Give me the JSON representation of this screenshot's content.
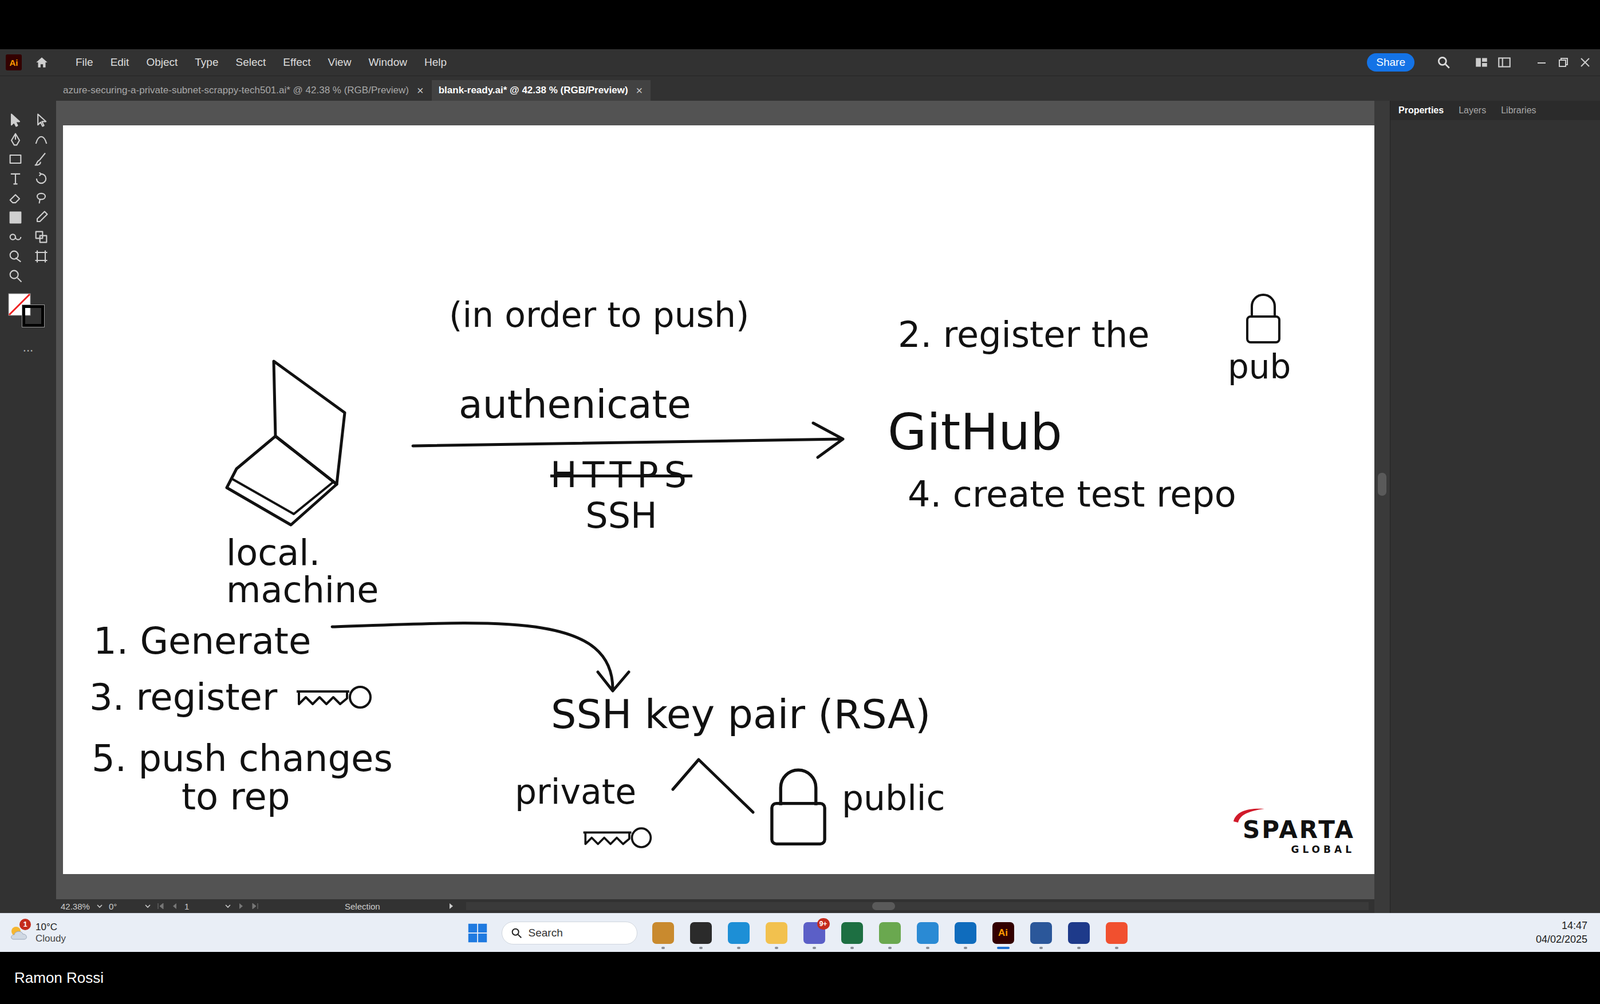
{
  "app_logo": "Ai",
  "menu": [
    "File",
    "Edit",
    "Object",
    "Type",
    "Select",
    "Effect",
    "View",
    "Window",
    "Help"
  ],
  "share": "Share",
  "tabs": [
    {
      "label": "azure-securing-a-private-subnet-scrappy-tech501.ai* @ 42.38 % (RGB/Preview)",
      "selected": false,
      "close": "×"
    },
    {
      "label": "blank-ready.ai* @ 42.38 % (RGB/Preview)",
      "selected": true,
      "close": "×"
    }
  ],
  "toolbar_more": "...",
  "panel_tabs": [
    {
      "label": "Properties",
      "selected": true
    },
    {
      "label": "Layers",
      "selected": false
    },
    {
      "label": "Libraries",
      "selected": false
    }
  ],
  "diagram": {
    "note": "(in order to push)",
    "arrow_label": "authenicate",
    "protocols": [
      {
        "label": "HTTPS",
        "struck": true
      },
      {
        "label": "SSH",
        "struck": false
      }
    ],
    "step2": "2. register the",
    "step2_suffix": "pub",
    "github": "GitHub",
    "step4": "4. create test repo",
    "machine": [
      "local.",
      "machine"
    ],
    "step1": "1. Generate",
    "step3": "3. register",
    "step5": [
      "5. push changes",
      "to rep"
    ],
    "key_pair": "SSH key pair (RSA)",
    "private": "private",
    "public": "public"
  },
  "logo": {
    "name": "SPARTA",
    "sub": "GLOBAL"
  },
  "status_bar": {
    "zoom": "42.38%",
    "rotation": "0°",
    "artboard": "1",
    "tool": "Selection"
  },
  "taskbar": {
    "weather": {
      "badge": "1",
      "temp": "10°C",
      "condition": "Cloudy"
    },
    "search": "Search",
    "apps": [
      {
        "label": "",
        "badge": "",
        "active": false,
        "color": "#c98a2e"
      },
      {
        "label": "",
        "badge": "",
        "active": false,
        "color": "#2b2b2b"
      },
      {
        "label": "",
        "badge": "",
        "active": false,
        "color": "#1d8fd6"
      },
      {
        "label": "",
        "badge": "",
        "active": false,
        "color": "#f2c14e"
      },
      {
        "label": "",
        "badge": "9+",
        "active": false,
        "color": "#5b5fc7"
      },
      {
        "label": "",
        "badge": "",
        "active": false,
        "color": "#1d6f42"
      },
      {
        "label": "",
        "badge": "",
        "active": false,
        "color": "#6aa84f"
      },
      {
        "label": "",
        "badge": "",
        "active": false,
        "color": "#2a8ad4"
      },
      {
        "label": "",
        "badge": "",
        "active": false,
        "color": "#0f6cbd"
      },
      {
        "label": "Ai",
        "badge": "",
        "active": true,
        "color": "#330000"
      },
      {
        "label": "",
        "badge": "",
        "active": false,
        "color": "#2b579a"
      },
      {
        "label": "",
        "badge": "",
        "active": false,
        "color": "#1e3a8a"
      },
      {
        "label": "",
        "badge": "",
        "active": false,
        "color": "#f1502f"
      }
    ],
    "time": "14:47",
    "date": "04/02/2025"
  },
  "presenter": "Ramon Rossi"
}
